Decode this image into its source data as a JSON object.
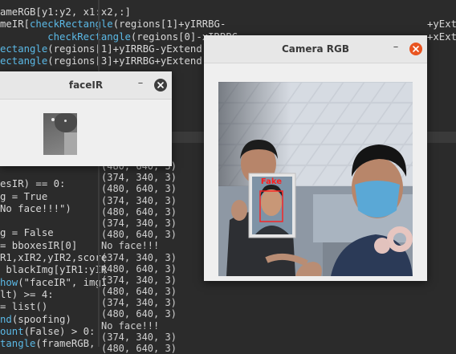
{
  "code_lines": [
    {
      "segments": [
        {
          "t": "ameRGB[y1:y2, x1:x2,:]",
          "c": ""
        }
      ]
    },
    {
      "segments": [
        {
          "t": "meIR[",
          "c": ""
        },
        {
          "t": "checkRectangle",
          "c": "fn"
        },
        {
          "t": "(regions[1]+yIRRBG-",
          "c": ""
        }
      ]
    },
    {
      "segments": [
        {
          "t": "        ",
          "c": ""
        },
        {
          "t": "checkRectangle",
          "c": "fn"
        },
        {
          "t": "(regions[0]-xIRRBG-",
          "c": ""
        }
      ]
    },
    {
      "segments": [
        {
          "t": "ectangle",
          "c": "fn"
        },
        {
          "t": "(regions[1]+yIRRBG-yExtend)",
          "c": ""
        }
      ]
    },
    {
      "segments": [
        {
          "t": "ectangle",
          "c": "fn"
        },
        {
          "t": "(regions[3]+yIRRBG+yExtend)",
          "c": ""
        }
      ]
    },
    {
      "segments": [
        {
          "t": "                                   nd)",
          "c": ""
        }
      ]
    },
    {
      "segments": [
        {
          "t": "                                   nd)",
          "c": ""
        }
      ]
    },
    {
      "segments": [
        {
          "t": "",
          "c": ""
        }
      ]
    },
    {
      "segments": [
        {
          "t": "",
          "c": ""
        }
      ]
    },
    {
      "segments": [
        {
          "t": "",
          "c": ""
        }
      ]
    },
    {
      "segments": [
        {
          "t": "",
          "c": ""
        }
      ]
    },
    {
      "segments": [
        {
          "t": "",
          "c": ""
        }
      ]
    },
    {
      "segments": [
        {
          "t": "scrfd.",
          "c": ""
        },
        {
          "t": "processing_o",
          "c": "fn"
        }
      ]
    },
    {
      "segments": [
        {
          "t": "",
          "c": ""
        }
      ]
    },
    {
      "segments": [
        {
          "t": "esIR) == 0:",
          "c": ""
        }
      ]
    },
    {
      "segments": [
        {
          "t": "g = True",
          "c": ""
        }
      ]
    },
    {
      "segments": [
        {
          "t": "No face!!!\")",
          "c": ""
        }
      ]
    },
    {
      "segments": [
        {
          "t": "",
          "c": ""
        }
      ]
    },
    {
      "segments": [
        {
          "t": "g = False",
          "c": ""
        }
      ]
    },
    {
      "segments": [
        {
          "t": "= bboxesIR[0]",
          "c": ""
        }
      ]
    },
    {
      "segments": [
        {
          "t": "R1,xIR2,yIR2,score",
          "c": ""
        }
      ]
    },
    {
      "segments": [
        {
          "t": " blackImg[yIR1:yIR",
          "c": ""
        }
      ]
    },
    {
      "segments": [
        {
          "t": "how",
          "c": "fn"
        },
        {
          "t": "(\"faceIR\", imgI",
          "c": ""
        }
      ]
    },
    {
      "segments": [
        {
          "t": "lt) >= 4:",
          "c": ""
        }
      ]
    },
    {
      "segments": [
        {
          "t": "= list()",
          "c": ""
        }
      ]
    },
    {
      "segments": [
        {
          "t": "nd",
          "c": "fn"
        },
        {
          "t": "(spoofing)",
          "c": ""
        }
      ]
    },
    {
      "segments": [
        {
          "t": "ount",
          "c": "fn"
        },
        {
          "t": "(False) > 0:",
          "c": ""
        }
      ]
    },
    {
      "segments": [
        {
          "t": "tangle",
          "c": "fn"
        },
        {
          "t": "(frameRGB,",
          "c": ""
        }
      ]
    }
  ],
  "right_code": [
    {
      "row": 1,
      "text": "+yExt"
    },
    {
      "row": 2,
      "text": "+xExt"
    }
  ],
  "terminal_lines": [
    "(480, 640, 3)",
    "(374, 340, 3)",
    "(480, 640, 3)",
    "(374, 340, 3)",
    "(480, 640, 3)",
    "(374, 340, 3)",
    "(480, 640, 3)",
    "No face!!!",
    "(374, 340, 3)",
    "(480, 640, 3)",
    "(374, 340, 3)",
    "(480, 640, 3)",
    "(374, 340, 3)",
    "(480, 640, 3)",
    "No face!!!",
    "(374, 340, 3)",
    "(480, 640, 3)"
  ],
  "face_ir_window": {
    "title": "faceIR",
    "minimize_label": "–"
  },
  "camera_window": {
    "title": "Camera RGB",
    "minimize_label": "–",
    "detection_label": "Fake"
  },
  "colors": {
    "close_button_active": "#e95420",
    "close_button_inactive": "#3d3d3d",
    "detection_box": "#ff1e1e"
  }
}
